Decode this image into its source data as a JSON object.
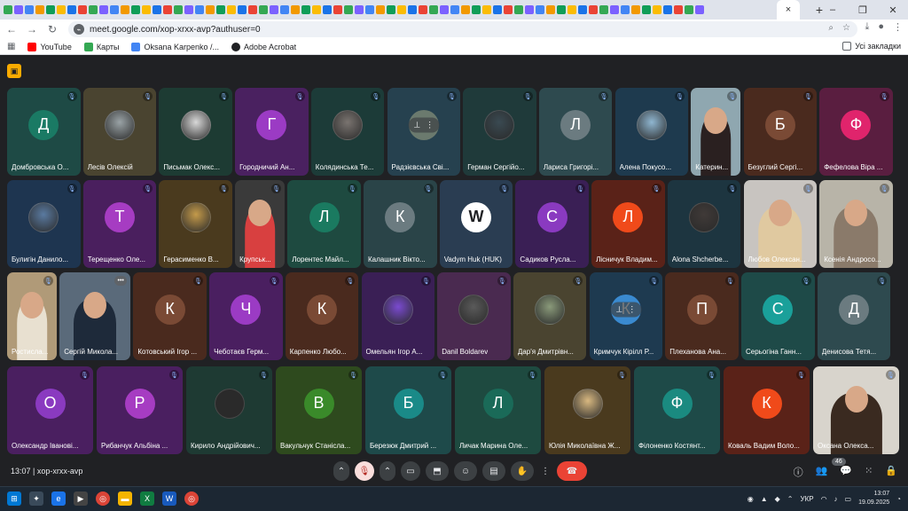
{
  "window": {
    "url": "meet.google.com/xop-xrxx-avp?authuser=0",
    "active_tab_close": "×",
    "new_tab": "+",
    "min": "–",
    "max": "❐",
    "close": "✕"
  },
  "bookmarks": {
    "items": [
      {
        "label": "YouTube",
        "color": "#ff0000"
      },
      {
        "label": "Карты",
        "color": "#34a853"
      },
      {
        "label": "Oksana Karpenko /...",
        "color": "#4285f4"
      },
      {
        "label": "Adobe Acrobat",
        "color": "#202124"
      }
    ],
    "all_label": "Усі закладки"
  },
  "tiles": [
    {
      "name": "Домбровська О...",
      "initial": "Д",
      "bg": "#1e4a45",
      "av": "#1a7a64",
      "type": "initial"
    },
    {
      "name": "Лесів Олексій",
      "initial": "",
      "bg": "#4a4430",
      "av": "#9aa3a6",
      "type": "photo"
    },
    {
      "name": "Письмак Олекс...",
      "initial": "",
      "bg": "#1d3b33",
      "av": "#d8d8d8",
      "type": "photo"
    },
    {
      "name": "Городничий Ан...",
      "initial": "Г",
      "bg": "#4a2160",
      "av": "#9b3bc4",
      "type": "initial"
    },
    {
      "name": "Колядинська Те...",
      "initial": "",
      "bg": "#1c3b38",
      "av": "#7a7470",
      "type": "photo"
    },
    {
      "name": "Радзієвська Сві...",
      "initial": "",
      "bg": "#26414f",
      "av": "#6b7a6e",
      "type": "hover"
    },
    {
      "name": "Герман Сергійо...",
      "initial": "",
      "bg": "#1f3a3a",
      "av": "#3a4a52",
      "type": "photo"
    },
    {
      "name": "Лариса Григорі...",
      "initial": "Л",
      "bg": "#2e4a4f",
      "av": "#6b7b80",
      "type": "initial"
    },
    {
      "name": "Алена Покусо...",
      "initial": "",
      "bg": "#1e3a4e",
      "av": "#8fb6d0",
      "type": "photo"
    },
    {
      "name": "Катерин...",
      "initial": "",
      "bg": "#8fa7b0",
      "av": "",
      "type": "video"
    },
    {
      "name": "Безуглий Сергі...",
      "initial": "Б",
      "bg": "#4a2a1e",
      "av": "#7a4a35",
      "type": "initial"
    },
    {
      "name": "Фефелова Віра ...",
      "initial": "Ф",
      "bg": "#5a1e40",
      "av": "#e0246c",
      "type": "initial"
    },
    {
      "name": "Булигін Данило...",
      "initial": "",
      "bg": "#1e3550",
      "av": "#5a7aa0",
      "type": "photo"
    },
    {
      "name": "Терещенко Оле...",
      "initial": "Т",
      "bg": "#4a1f5e",
      "av": "#a63cc2",
      "type": "initial"
    },
    {
      "name": "Герасименко В...",
      "initial": "",
      "bg": "#4a3a1e",
      "av": "#c49a4a",
      "type": "photo"
    },
    {
      "name": "Крупськ...",
      "initial": "",
      "bg": "#3a3a3a",
      "av": "",
      "type": "video2"
    },
    {
      "name": "Лорентес Майл...",
      "initial": "Л",
      "bg": "#1e4a40",
      "av": "#1a7a60",
      "type": "initial"
    },
    {
      "name": "Калашник Вікто...",
      "initial": "К",
      "bg": "#2a4448",
      "av": "#6b7b80",
      "type": "initial"
    },
    {
      "name": "Vadym Huk (HUK)",
      "initial": "W",
      "bg": "#2a3d52",
      "av": "#ffffff",
      "type": "logo"
    },
    {
      "name": "Садиков Русла...",
      "initial": "С",
      "bg": "#3a1f55",
      "av": "#8a3ac0",
      "type": "initial"
    },
    {
      "name": "Лісничук Владим...",
      "initial": "Л",
      "bg": "#5a2218",
      "av": "#f04a1a",
      "type": "initial"
    },
    {
      "name": "Alona Shcherbe...",
      "initial": "",
      "bg": "#1d3540",
      "av": "#403a38",
      "type": "photo"
    },
    {
      "name": "Любов Олексан...",
      "initial": "",
      "bg": "#c8c4c0",
      "av": "",
      "type": "video3"
    },
    {
      "name": "Ксенія Андросо...",
      "initial": "",
      "bg": "#b8b4a8",
      "av": "",
      "type": "video4"
    },
    {
      "name": "Ростисла...",
      "initial": "",
      "bg": "#b09a78",
      "av": "",
      "type": "video5"
    },
    {
      "name": "Сергій Микола...",
      "initial": "",
      "bg": "#5a6a7a",
      "av": "",
      "type": "video6"
    },
    {
      "name": "Котовський Ігор ...",
      "initial": "К",
      "bg": "#4a2a1e",
      "av": "#7a4a35",
      "type": "initial"
    },
    {
      "name": "Чеботаєв Герм...",
      "initial": "Ч",
      "bg": "#4a1f60",
      "av": "#9b3bc4",
      "type": "initial"
    },
    {
      "name": "Карпенко Любо...",
      "initial": "К",
      "bg": "#4a2a1e",
      "av": "#7a4a35",
      "type": "initial"
    },
    {
      "name": "Омельян Ігор А...",
      "initial": "",
      "bg": "#3a1f55",
      "av": "#7a4ad0",
      "type": "photo"
    },
    {
      "name": "Danil Boldarev",
      "initial": "",
      "bg": "#4a2a50",
      "av": "#5a5a5a",
      "type": "photo"
    },
    {
      "name": "Дар'я Дмитрівн...",
      "initial": "",
      "bg": "#4a4430",
      "av": "#8a9a7a",
      "type": "photo"
    },
    {
      "name": "Кримчук Кірілл Р...",
      "initial": "К",
      "bg": "#1e3a50",
      "av": "#3a8ad0",
      "type": "hover2"
    },
    {
      "name": "Плеханова Ана...",
      "initial": "П",
      "bg": "#4a2a1e",
      "av": "#7a4a35",
      "type": "initial"
    },
    {
      "name": "Серьогіна Ганн...",
      "initial": "С",
      "bg": "#1e4a48",
      "av": "#1aa09a",
      "type": "initial"
    },
    {
      "name": "Денисова Тетя...",
      "initial": "Д",
      "bg": "#2e4a4f",
      "av": "#6b7b80",
      "type": "initial"
    },
    {
      "name": "Олександр Іванові...",
      "initial": "О",
      "bg": "#4a1f60",
      "av": "#8a3ac0",
      "type": "initial"
    },
    {
      "name": "Рибанчук Альбіна ...",
      "initial": "Р",
      "bg": "#4a1f60",
      "av": "#a63cc2",
      "type": "initial"
    },
    {
      "name": "Кирило Андрійович...",
      "initial": "",
      "bg": "#1e3a33",
      "av": "#2a2a2a",
      "type": "photo"
    },
    {
      "name": "Вакульчук Станісла...",
      "initial": "В",
      "bg": "#2e4a1e",
      "av": "#3a8a2a",
      "type": "initial"
    },
    {
      "name": "Березюк Дмитрий ...",
      "initial": "Б",
      "bg": "#1e4a4a",
      "av": "#1a8a88",
      "type": "initial"
    },
    {
      "name": "Личак Марина Оле...",
      "initial": "Л",
      "bg": "#1e4a40",
      "av": "#1a6a58",
      "type": "initial"
    },
    {
      "name": "Юлія Миколаївна Ж...",
      "initial": "",
      "bg": "#4a3a1e",
      "av": "#d8b880",
      "type": "photo"
    },
    {
      "name": "Філоненко Костянт...",
      "initial": "Ф",
      "bg": "#1e4a48",
      "av": "#1a8a80",
      "type": "initial"
    },
    {
      "name": "Коваль Вадим Воло...",
      "initial": "К",
      "bg": "#5a2218",
      "av": "#f04a1a",
      "type": "initial"
    },
    {
      "name": "Оксана Олекса...",
      "initial": "",
      "bg": "#d8d4cc",
      "av": "",
      "type": "video7"
    }
  ],
  "bottom": {
    "time": "13:07",
    "meeting_code": "xop-xrxx-avp",
    "participants": "46"
  },
  "taskbar": {
    "lang": "УКР",
    "time": "13:07",
    "date": "19.09.2025"
  }
}
